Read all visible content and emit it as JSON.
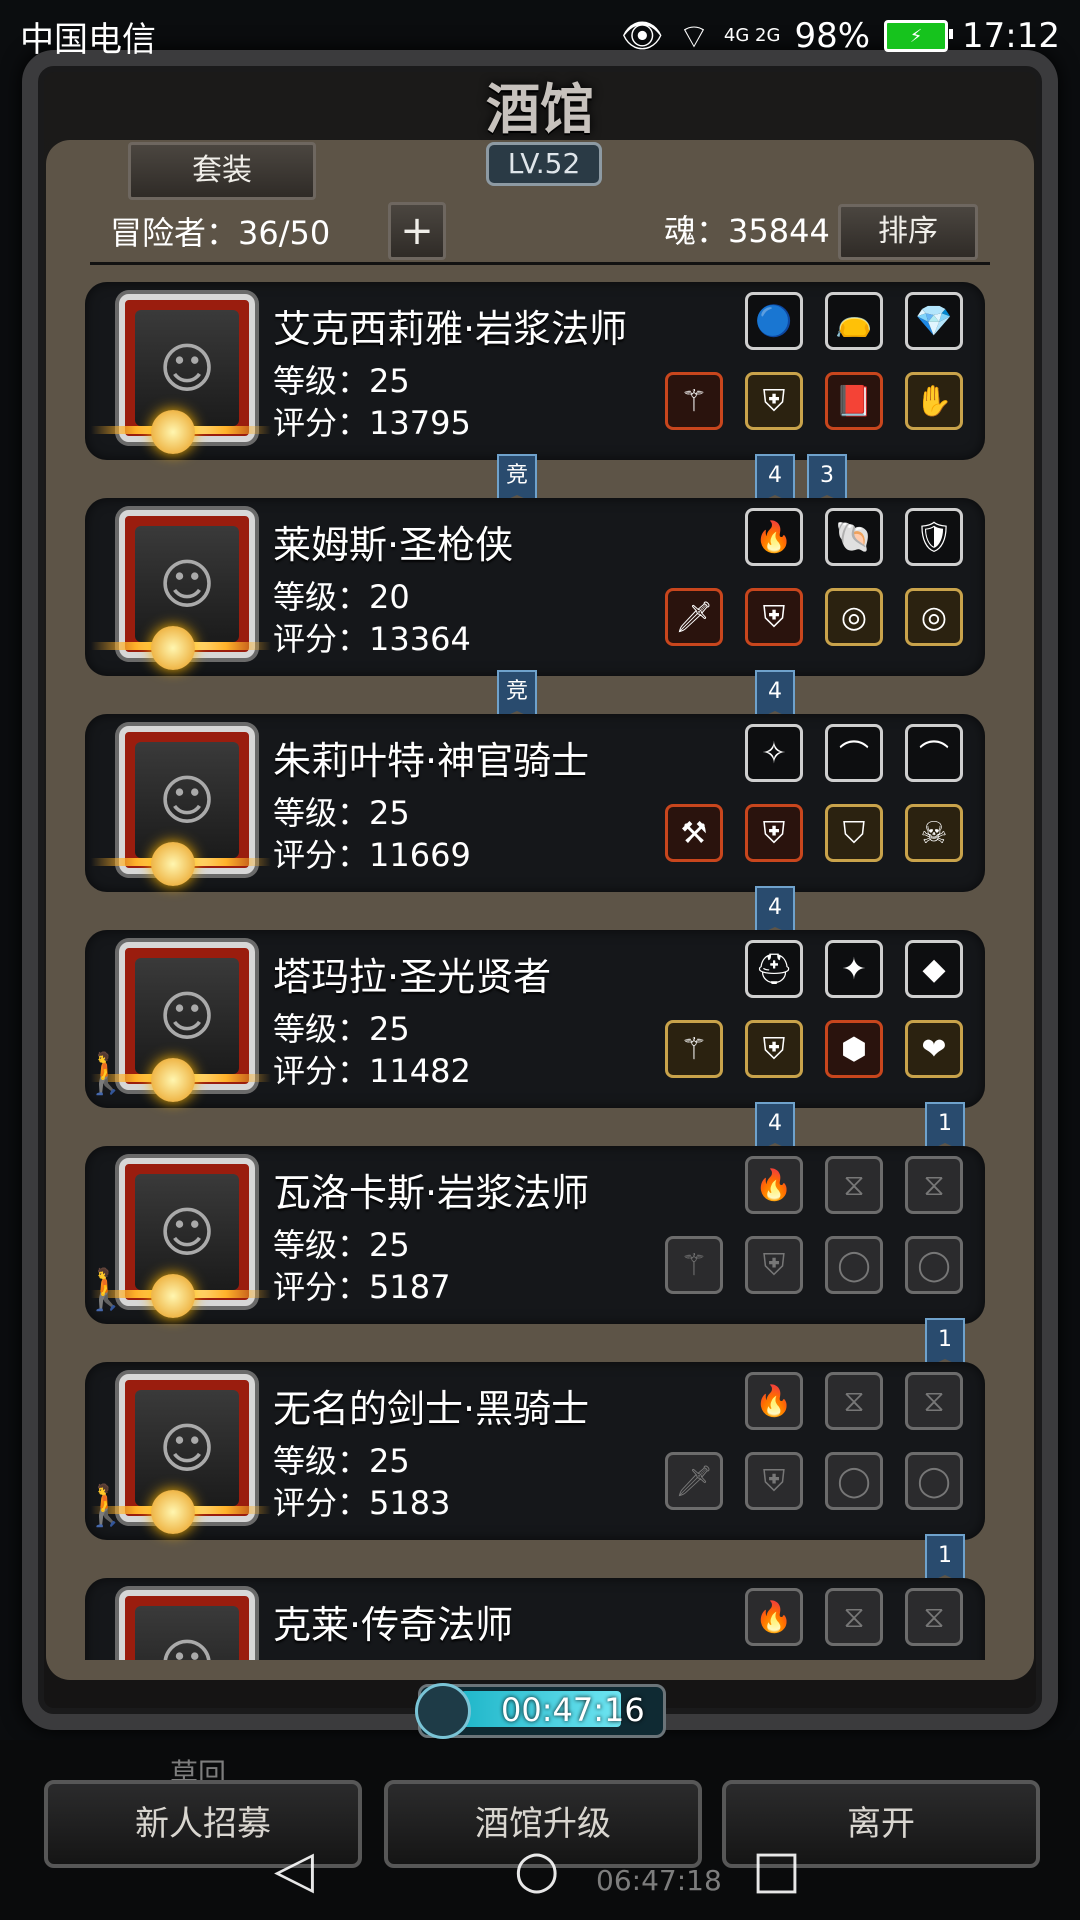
{
  "status": {
    "carrier": "中国电信",
    "network": "4G 2G",
    "battery": "98%",
    "time": "17:12"
  },
  "header": {
    "title": "酒馆",
    "level": "LV.52",
    "set_button": "套装",
    "adventurers": "冒险者：36/50",
    "soul": "魂：35844",
    "sort_button": "排序",
    "plus": "+"
  },
  "heroes": [
    {
      "name": "艾克西莉雅·岩浆法师",
      "level": "等级：25",
      "score": "评分：13795",
      "ribbons": [
        "竞",
        "4",
        "3"
      ]
    },
    {
      "name": "莱姆斯·圣枪侠",
      "level": "等级：20",
      "score": "评分：13364",
      "ribbons": [
        "竞",
        "4"
      ]
    },
    {
      "name": "朱莉叶特·神官骑士",
      "level": "等级：25",
      "score": "评分：11669",
      "ribbons": [
        "4"
      ]
    },
    {
      "name": "塔玛拉·圣光贤者",
      "level": "等级：25",
      "score": "评分：11482",
      "ribbons": [
        "4",
        "1"
      ]
    },
    {
      "name": "瓦洛卡斯·岩浆法师",
      "level": "等级：25",
      "score": "评分：5187",
      "ribbons": [
        "1"
      ]
    },
    {
      "name": "无名的剑士·黑骑士",
      "level": "等级：25",
      "score": "评分：5183",
      "ribbons": [
        "1"
      ]
    },
    {
      "name": "克莱·传奇法师",
      "level": "",
      "score": ""
    }
  ],
  "timer": {
    "value": "00:47:16"
  },
  "bottom": {
    "recruit": "新人招募",
    "upgrade": "酒馆升级",
    "leave": "离开",
    "bg_timer": "06:47:18",
    "bg_label": "草回"
  }
}
